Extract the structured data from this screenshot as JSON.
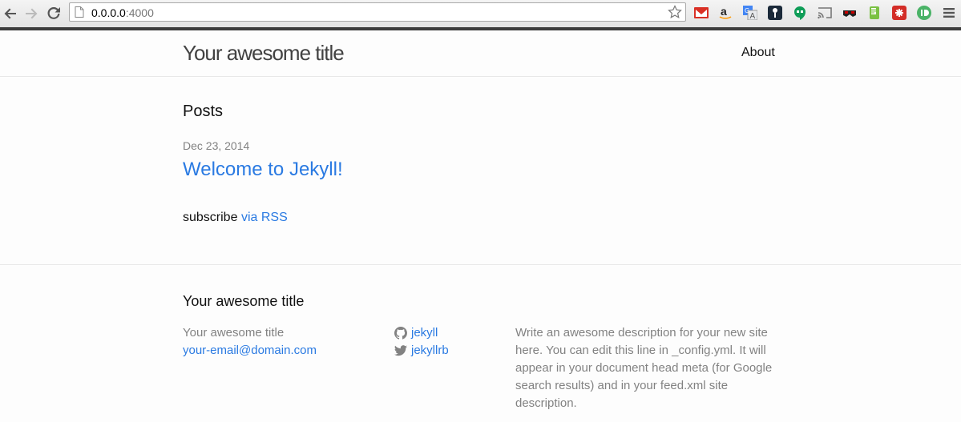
{
  "browser": {
    "url_host": "0.0.0.0",
    "url_port": ":4000",
    "extensions": [
      "gmail-icon",
      "amazon-icon",
      "translate-icon",
      "keeper-icon",
      "hangouts-icon",
      "cast-icon",
      "mask-icon",
      "evernote-icon",
      "lastpass-icon",
      "pushbullet-icon",
      "menu-icon"
    ]
  },
  "header": {
    "site_title": "Your awesome title",
    "nav": {
      "about": "About"
    }
  },
  "main": {
    "posts_heading": "Posts",
    "posts": [
      {
        "date": "Dec 23, 2014",
        "title": "Welcome to Jekyll!"
      }
    ],
    "subscribe_text": "subscribe",
    "subscribe_link": "via RSS"
  },
  "footer": {
    "heading": "Your awesome title",
    "name": "Your awesome title",
    "email": "your-email@domain.com",
    "github_username": "jekyll",
    "twitter_username": "jekyllrb",
    "description": "Write an awesome description for your new site here. You can edit this line in _config.yml. It will appear in your document head meta (for Google search results) and in your feed.xml site description."
  },
  "colors": {
    "link": "#2a7ae2",
    "meta": "#828282",
    "title": "#424242"
  }
}
